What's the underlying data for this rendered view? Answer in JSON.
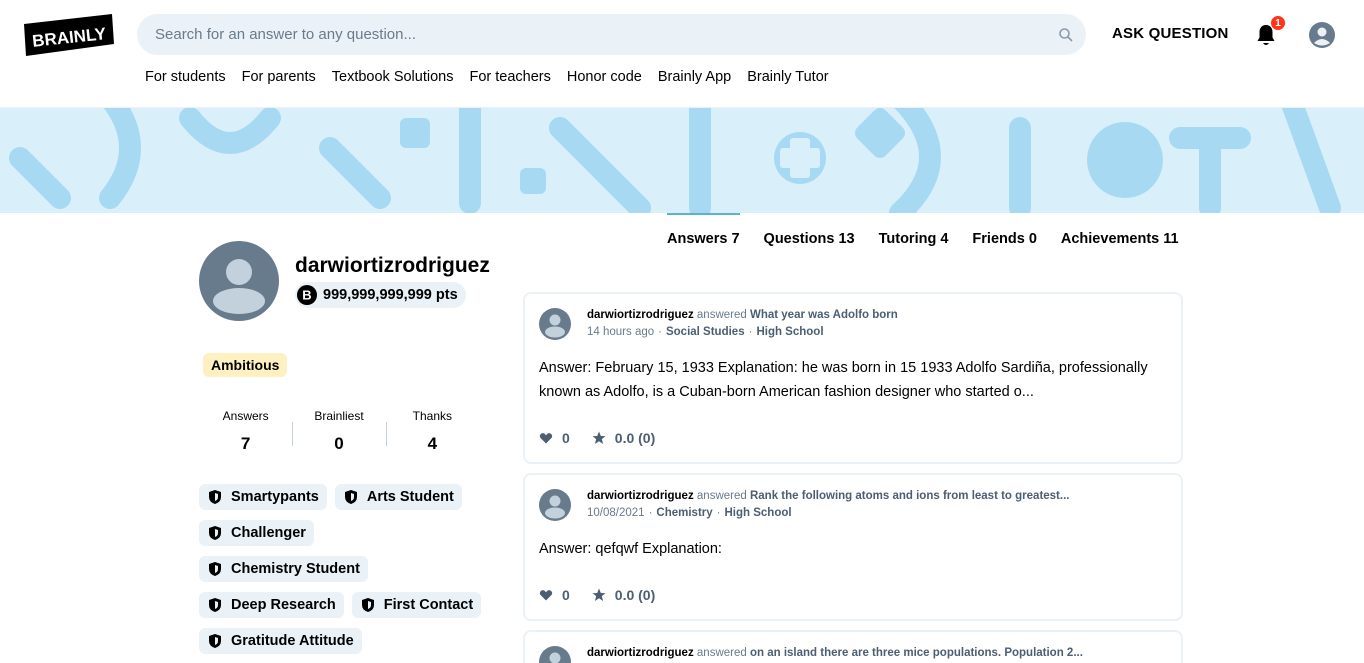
{
  "header": {
    "logo_text": "BRAINLY",
    "search_placeholder": "Search for an answer to any question...",
    "ask_label": "ASK QUESTION",
    "notification_count": "1",
    "nav": [
      "For students",
      "For parents",
      "Textbook Solutions",
      "For teachers",
      "Honor code",
      "Brainly App",
      "Brainly Tutor"
    ]
  },
  "profile": {
    "username": "darwiortizrodriguez",
    "points": "999,999,999,999 pts",
    "rank": "Ambitious",
    "stats": [
      {
        "label": "Answers",
        "value": "7"
      },
      {
        "label": "Brainliest",
        "value": "0"
      },
      {
        "label": "Thanks",
        "value": "4"
      }
    ],
    "badges": [
      "Smartypants",
      "Arts Student",
      "Challenger",
      "Chemistry Student",
      "Deep Research",
      "First Contact",
      "Gratitude Attitude"
    ]
  },
  "tabs": [
    {
      "label": "Answers 7",
      "active": true
    },
    {
      "label": "Questions 13",
      "active": false
    },
    {
      "label": "Tutoring 4",
      "active": false
    },
    {
      "label": "Friends 0",
      "active": false
    },
    {
      "label": "Achievements 11",
      "active": false
    }
  ],
  "answers": [
    {
      "author": "darwiortizrodriguez",
      "verb": "answered",
      "question": "What year was Adolfo born",
      "time": "14 hours ago",
      "subject": "Social Studies",
      "level": "High School",
      "body": "Answer: February 15, 1933 Explanation: he was born in 15 1933 Adolfo Sardiña, professionally known as Adolfo, is a Cuban-born American fashion designer who started o...",
      "thanks": "0",
      "rating": "0.0 (0)"
    },
    {
      "author": "darwiortizrodriguez",
      "verb": "answered",
      "question": "Rank the following atoms and ions from least to greatest...",
      "time": "10/08/2021",
      "subject": "Chemistry",
      "level": "High School",
      "body": "Answer: qefqwf Explanation:",
      "thanks": "0",
      "rating": "0.0 (0)"
    },
    {
      "author": "darwiortizrodriguez",
      "verb": "answered",
      "question": "on an island there are three mice populations. Population 2...",
      "time": "",
      "subject": "",
      "level": "",
      "body": "",
      "thanks": "",
      "rating": ""
    }
  ],
  "colors": {
    "banner": "#d9f0fa",
    "banner_shapes": "#a8d9f3",
    "tab_active": "#5ab4cf",
    "badge_bg": "#ebf2f7",
    "rank_bg": "#fff0c2",
    "notification": "#ff341a",
    "avatar": "#687b8c"
  },
  "icons": {
    "search": "search-icon",
    "bell": "bell-icon",
    "profile": "user-avatar-icon",
    "points": "brainly-points-icon",
    "badge": "shield-icon",
    "heart": "heart-icon",
    "star": "star-icon"
  }
}
